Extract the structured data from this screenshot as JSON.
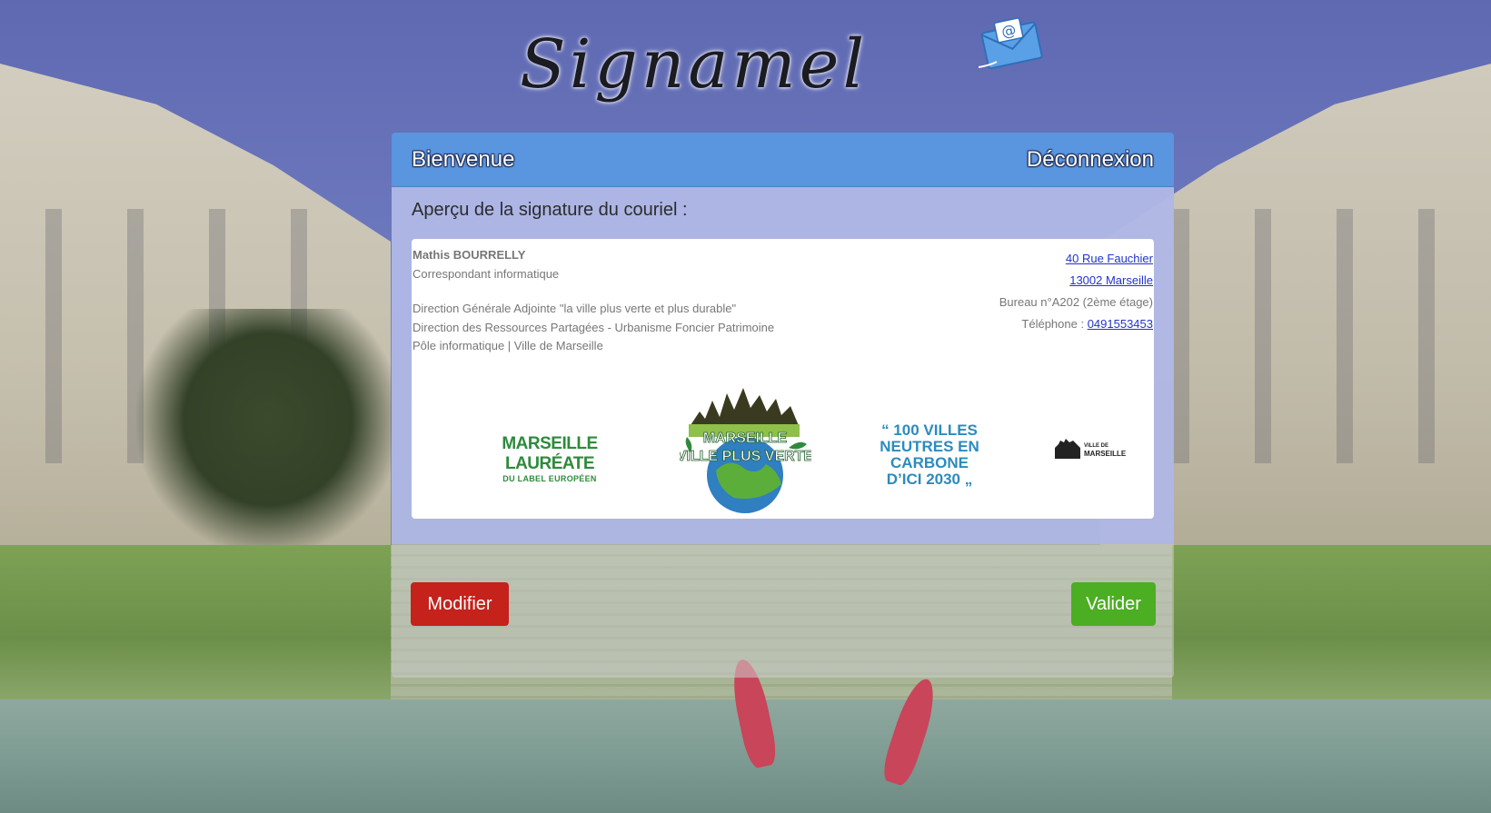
{
  "app": {
    "logo_text": "Signamel",
    "logo_icon": "email-envelope-icon"
  },
  "card": {
    "header": {
      "title": "Bienvenue",
      "logout_label": "Déconnexion"
    },
    "preview_heading": "Aperçu de la signature du couriel :",
    "signature": {
      "name": "Mathis BOURRELLY",
      "role": "Correspondant informatique",
      "lines": [
        "Direction Générale Adjointe \"la ville plus verte et plus durable\"",
        "Direction des Ressources Partagées - Urbanisme Foncier Patrimoine",
        "Pôle informatique | Ville de Marseille"
      ],
      "address_line1": "40 Rue Fauchier",
      "address_line2": "13002 Marseille",
      "office": "Bureau n°A202 (2ème étage)",
      "phone_label": "Téléphone : ",
      "phone": "0491553453"
    },
    "logos": {
      "laureate_big": "MARSEILLE LAURÉATE",
      "laureate_small": "DU LABEL EUROPÉEN",
      "plusverte_line1": "MARSEILLE",
      "plusverte_line2": "VILLE PLUS VERTE",
      "cent_villes": [
        "“ 100 VILLES",
        "NEUTRES EN CARBONE",
        "D’ICI 2030 „"
      ],
      "ville_top": "VILLE DE",
      "ville_bottom": "MARSEILLE"
    },
    "buttons": {
      "modifier": "Modifier",
      "valider": "Valider"
    }
  },
  "colors": {
    "header_blue": "#5a95e0",
    "modifier_red": "#c4221b",
    "valider_green": "#4cae22",
    "link_blue": "#2233cc"
  }
}
